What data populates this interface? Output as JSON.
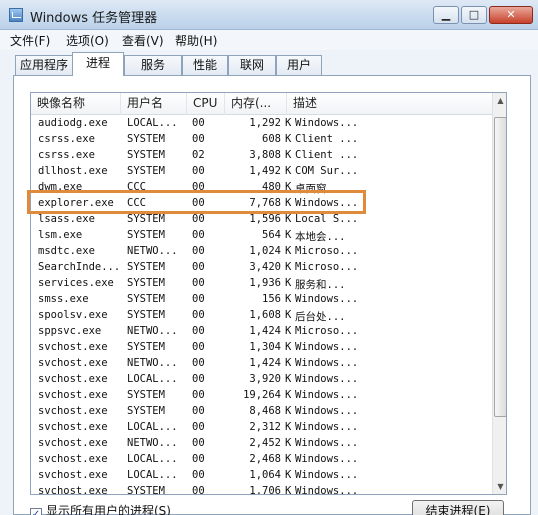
{
  "window": {
    "title": "Windows 任务管理器",
    "minimize": "▁",
    "maximize": "□",
    "close": "✕"
  },
  "menu": [
    "文件(F)",
    "选项(O)",
    "查看(V)",
    "帮助(H)"
  ],
  "tabs": [
    "应用程序",
    "进程",
    "服务",
    "性能",
    "联网",
    "用户"
  ],
  "active_tab": "进程",
  "columns": {
    "name": "映像名称",
    "user": "用户名",
    "cpu": "CPU",
    "mem": "内存(...",
    "desc": "描述"
  },
  "processes": [
    {
      "name": "audiodg.exe",
      "user": "LOCAL...",
      "cpu": "00",
      "mem": "1,292",
      "unit": "K",
      "desc": "Windows..."
    },
    {
      "name": "csrss.exe",
      "user": "SYSTEM",
      "cpu": "00",
      "mem": "608",
      "unit": "K",
      "desc": "Client ..."
    },
    {
      "name": "csrss.exe",
      "user": "SYSTEM",
      "cpu": "02",
      "mem": "3,808",
      "unit": "K",
      "desc": "Client ..."
    },
    {
      "name": "dllhost.exe",
      "user": "SYSTEM",
      "cpu": "00",
      "mem": "1,492",
      "unit": "K",
      "desc": "COM Sur..."
    },
    {
      "name": "dwm.exe",
      "user": "CCC",
      "cpu": "00",
      "mem": "480",
      "unit": "K",
      "desc": "桌面窗..."
    },
    {
      "name": "explorer.exe",
      "user": "CCC",
      "cpu": "00",
      "mem": "7,768",
      "unit": "K",
      "desc": "Windows..."
    },
    {
      "name": "lsass.exe",
      "user": "SYSTEM",
      "cpu": "00",
      "mem": "1,596",
      "unit": "K",
      "desc": "Local S..."
    },
    {
      "name": "lsm.exe",
      "user": "SYSTEM",
      "cpu": "00",
      "mem": "564",
      "unit": "K",
      "desc": "本地会..."
    },
    {
      "name": "msdtc.exe",
      "user": "NETWO...",
      "cpu": "00",
      "mem": "1,024",
      "unit": "K",
      "desc": "Microso..."
    },
    {
      "name": "SearchInde...",
      "user": "SYSTEM",
      "cpu": "00",
      "mem": "3,420",
      "unit": "K",
      "desc": "Microso..."
    },
    {
      "name": "services.exe",
      "user": "SYSTEM",
      "cpu": "00",
      "mem": "1,936",
      "unit": "K",
      "desc": "服务和..."
    },
    {
      "name": "smss.exe",
      "user": "SYSTEM",
      "cpu": "00",
      "mem": "156",
      "unit": "K",
      "desc": "Windows..."
    },
    {
      "name": "spoolsv.exe",
      "user": "SYSTEM",
      "cpu": "00",
      "mem": "1,608",
      "unit": "K",
      "desc": "后台处..."
    },
    {
      "name": "sppsvc.exe",
      "user": "NETWO...",
      "cpu": "00",
      "mem": "1,424",
      "unit": "K",
      "desc": "Microso..."
    },
    {
      "name": "svchost.exe",
      "user": "SYSTEM",
      "cpu": "00",
      "mem": "1,304",
      "unit": "K",
      "desc": "Windows..."
    },
    {
      "name": "svchost.exe",
      "user": "NETWO...",
      "cpu": "00",
      "mem": "1,424",
      "unit": "K",
      "desc": "Windows..."
    },
    {
      "name": "svchost.exe",
      "user": "LOCAL...",
      "cpu": "00",
      "mem": "3,920",
      "unit": "K",
      "desc": "Windows..."
    },
    {
      "name": "svchost.exe",
      "user": "SYSTEM",
      "cpu": "00",
      "mem": "19,264",
      "unit": "K",
      "desc": "Windows..."
    },
    {
      "name": "svchost.exe",
      "user": "SYSTEM",
      "cpu": "00",
      "mem": "8,468",
      "unit": "K",
      "desc": "Windows..."
    },
    {
      "name": "svchost.exe",
      "user": "LOCAL...",
      "cpu": "00",
      "mem": "2,312",
      "unit": "K",
      "desc": "Windows..."
    },
    {
      "name": "svchost.exe",
      "user": "NETWO...",
      "cpu": "00",
      "mem": "2,452",
      "unit": "K",
      "desc": "Windows..."
    },
    {
      "name": "svchost.exe",
      "user": "LOCAL...",
      "cpu": "00",
      "mem": "2,468",
      "unit": "K",
      "desc": "Windows..."
    },
    {
      "name": "svchost.exe",
      "user": "LOCAL...",
      "cpu": "00",
      "mem": "1,064",
      "unit": "K",
      "desc": "Windows..."
    },
    {
      "name": "svchost.exe",
      "user": "SYSTEM",
      "cpu": "00",
      "mem": "1,706",
      "unit": "K",
      "desc": "Windows..."
    }
  ],
  "highlighted_process": "explorer.exe",
  "highlight_color": "#e08a3b",
  "footer": {
    "show_all_label": "显示所有用户的进程(S)",
    "show_all_checked": "✓",
    "end_process_label": "结束进程(E)"
  }
}
